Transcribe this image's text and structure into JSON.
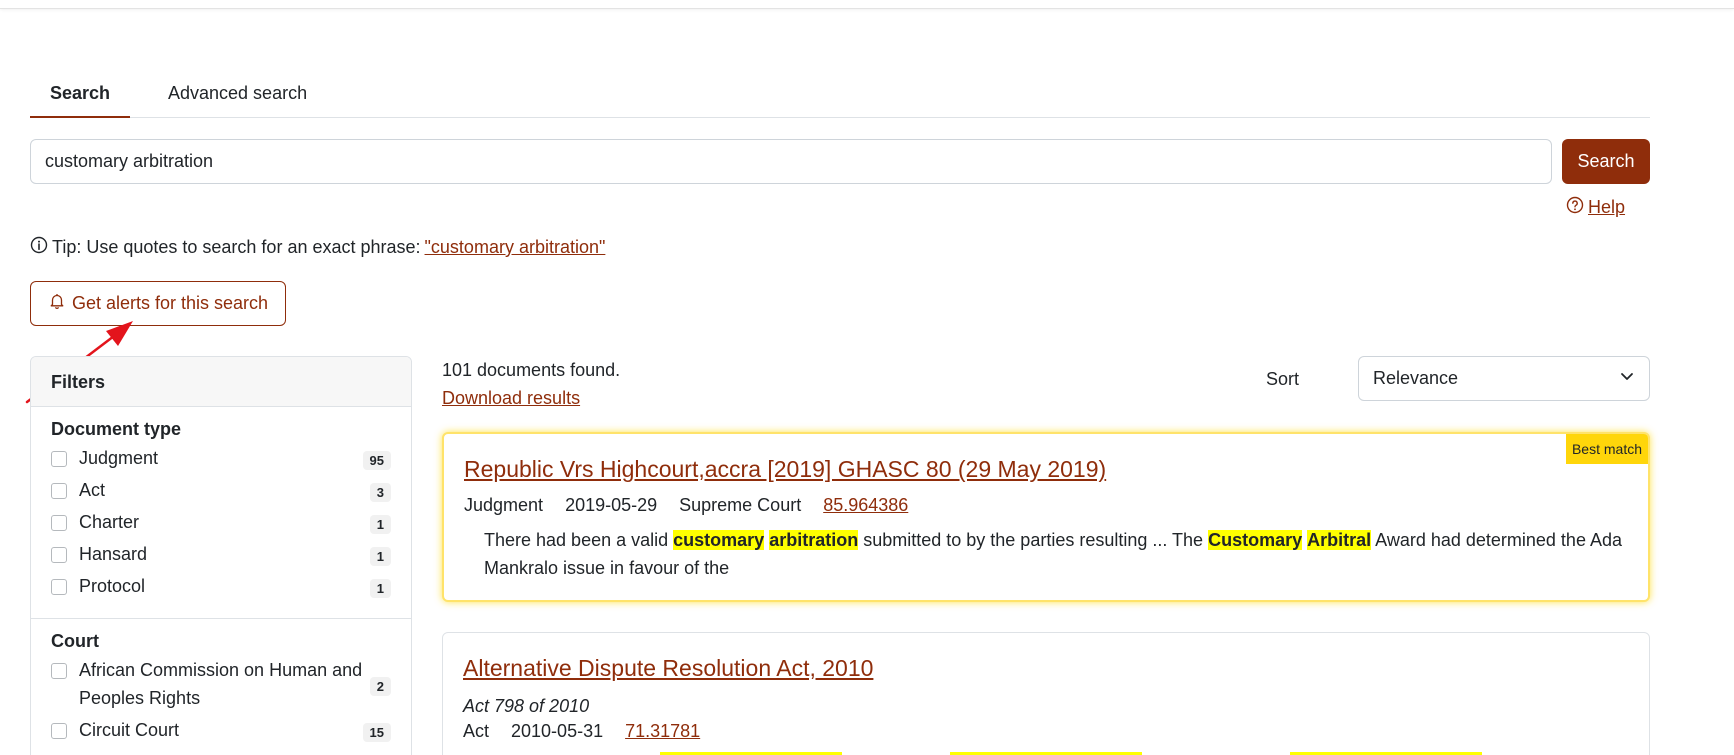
{
  "tabs": {
    "search": "Search",
    "advanced": "Advanced search"
  },
  "search": {
    "value": "customary arbitration",
    "button": "Search"
  },
  "help": {
    "label": "Help"
  },
  "tip": {
    "text": "Tip: Use quotes to search for an exact phrase:",
    "link": "\"customary arbitration\""
  },
  "alerts": {
    "label": "Get alerts for this search"
  },
  "filters": {
    "title": "Filters",
    "document_type": {
      "title": "Document type",
      "items": [
        {
          "label": "Judgment",
          "count": "95"
        },
        {
          "label": "Act",
          "count": "3"
        },
        {
          "label": "Charter",
          "count": "1"
        },
        {
          "label": "Hansard",
          "count": "1"
        },
        {
          "label": "Protocol",
          "count": "1"
        }
      ]
    },
    "court": {
      "title": "Court",
      "items": [
        {
          "label": "African Commission on Human and Peoples Rights",
          "count": "2"
        },
        {
          "label": "Circuit Court",
          "count": "15"
        }
      ]
    }
  },
  "results": {
    "count_text": "101 documents found.",
    "download": "Download results",
    "sort_label": "Sort",
    "sort_value": "Relevance",
    "items": [
      {
        "badge": "Best match",
        "title": "Republic Vrs Highcourt,accra [2019] GHASC 80 (29 May 2019)",
        "type": "Judgment",
        "date": "2019-05-29",
        "court": "Supreme Court",
        "score": "85.964386",
        "snippet": {
          "p1": "There had been a valid ",
          "h1": "customary",
          "h2": "arbitration",
          "p2": " submitted to by the parties resulting ... The ",
          "h3": "Customary",
          "h4": "Arbitral",
          "p3": " Award had determined the Ada Mankralo issue in favour of the"
        }
      },
      {
        "title": "Alternative Dispute Resolution Act, 2010",
        "subtitle": "Act 798 of 2010",
        "type": "Act",
        "date": "2010-05-31",
        "score": "71.31781"
      }
    ]
  },
  "colors": {
    "brand": "#8f2d0b",
    "highlight": "#ffff00",
    "badge": "#ffd60a",
    "annotation_arrow": "#e3141c"
  },
  "icons": {
    "help": "question-circle-icon",
    "tip": "info-circle-icon",
    "alerts": "bell-icon",
    "sort": "chevron-down-icon"
  }
}
